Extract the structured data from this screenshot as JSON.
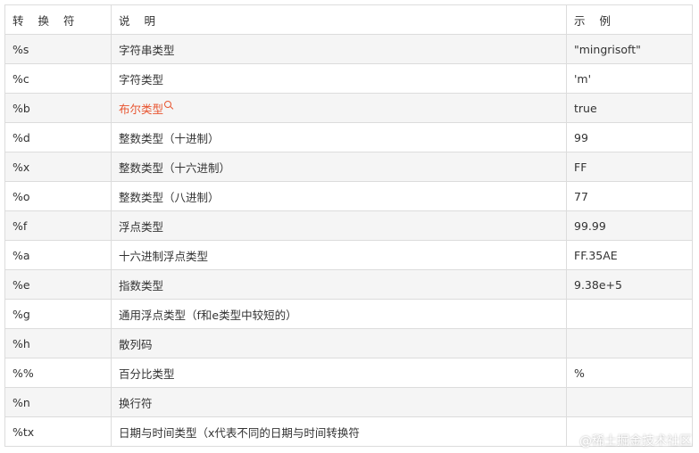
{
  "table": {
    "headers": [
      "转 换 符",
      "说 明",
      "示 例"
    ],
    "rows": [
      {
        "symbol": "%s",
        "desc": "字符串类型",
        "example": "\"mingrisoft\""
      },
      {
        "symbol": "%c",
        "desc": "字符类型",
        "example": "'m'"
      },
      {
        "symbol": "%b",
        "desc": "布尔类型",
        "example": "true",
        "link": true
      },
      {
        "symbol": "%d",
        "desc": "整数类型（十进制）",
        "example": "99"
      },
      {
        "symbol": "%x",
        "desc": "整数类型（十六进制）",
        "example": "FF"
      },
      {
        "symbol": "%o",
        "desc": "整数类型（八进制）",
        "example": "77"
      },
      {
        "symbol": "%f",
        "desc": "浮点类型",
        "example": "99.99"
      },
      {
        "symbol": "%a",
        "desc": "十六进制浮点类型",
        "example": "FF.35AE"
      },
      {
        "symbol": "%e",
        "desc": "指数类型",
        "example": "9.38e+5"
      },
      {
        "symbol": "%g",
        "desc": "通用浮点类型（f和e类型中较短的）",
        "example": ""
      },
      {
        "symbol": "%h",
        "desc": "散列码",
        "example": ""
      },
      {
        "symbol": "%%",
        "desc": "百分比类型",
        "example": "%"
      },
      {
        "symbol": "%n",
        "desc": "换行符",
        "example": ""
      },
      {
        "symbol": "%tx",
        "desc": "日期与时间类型（x代表不同的日期与时间转换符",
        "example": ""
      }
    ]
  },
  "watermark": "@稀土掘金技术社区",
  "colors": {
    "link": "#e8542f",
    "stripe": "#f5f5f5",
    "border": "#dcdcdc"
  }
}
